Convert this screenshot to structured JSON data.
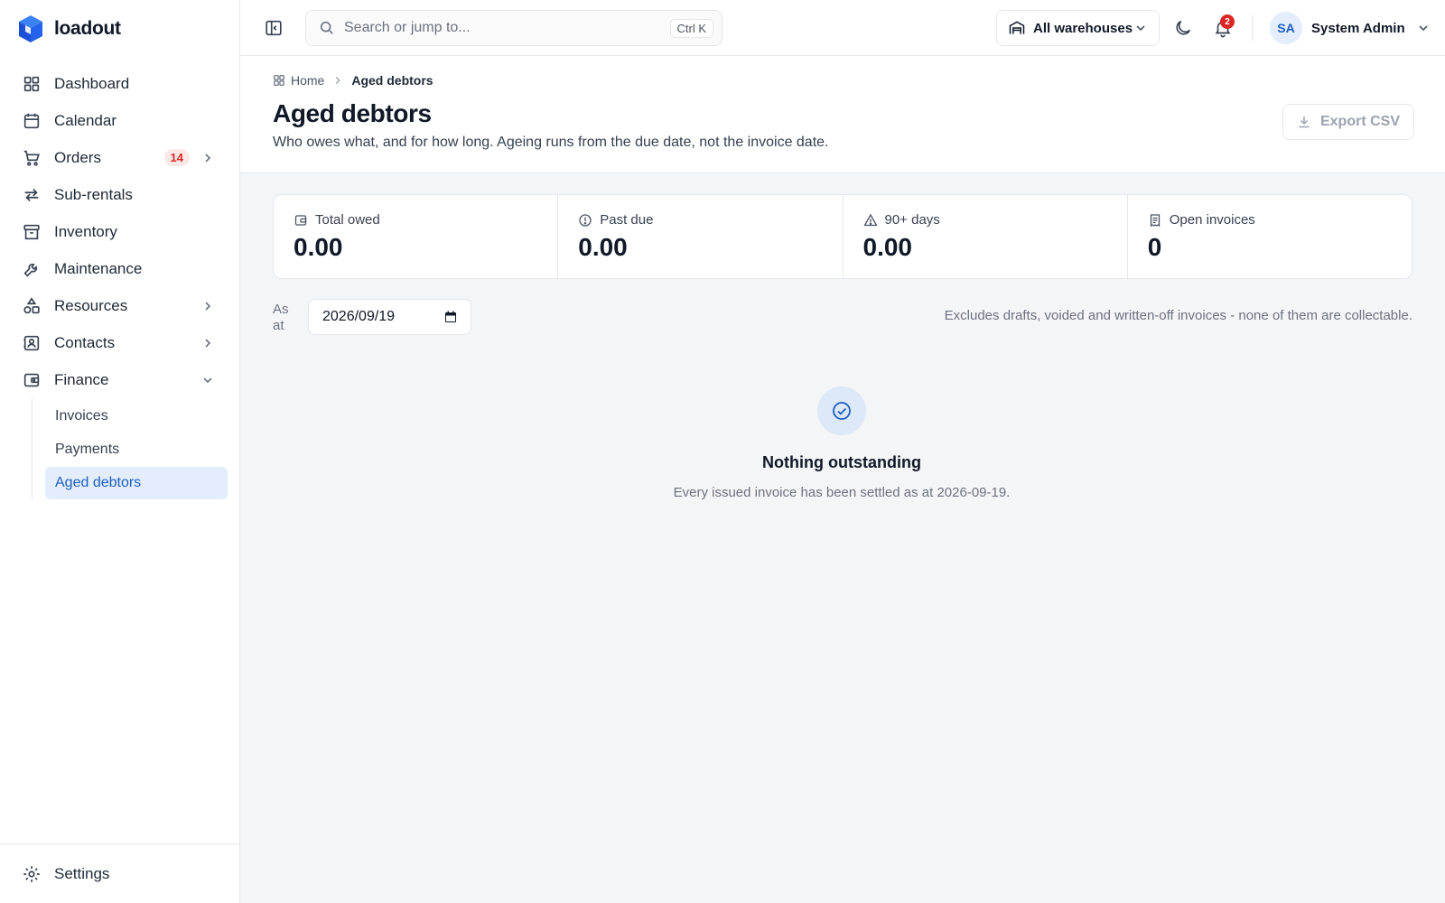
{
  "app": {
    "name": "loadout"
  },
  "sidebar": {
    "items": [
      {
        "label": "Dashboard",
        "icon": "grid-icon"
      },
      {
        "label": "Calendar",
        "icon": "calendar-icon"
      },
      {
        "label": "Orders",
        "icon": "cart-icon",
        "badge": "14"
      },
      {
        "label": "Sub-rentals",
        "icon": "arrows-icon"
      },
      {
        "label": "Inventory",
        "icon": "archive-icon"
      },
      {
        "label": "Maintenance",
        "icon": "wrench-icon"
      },
      {
        "label": "Resources",
        "icon": "shapes-icon"
      },
      {
        "label": "Contacts",
        "icon": "contact-icon"
      },
      {
        "label": "Finance",
        "icon": "wallet-icon"
      }
    ],
    "finance_sub": [
      {
        "label": "Invoices"
      },
      {
        "label": "Payments"
      },
      {
        "label": "Aged debtors",
        "active": true
      }
    ],
    "settings_label": "Settings"
  },
  "topbar": {
    "search_placeholder": "Search or jump to...",
    "search_shortcut": "Ctrl K",
    "warehouse_label": "All warehouses",
    "notifications_count": "2",
    "user_initials": "SA",
    "user_name": "System Admin"
  },
  "breadcrumb": {
    "home": "Home",
    "current": "Aged debtors"
  },
  "page": {
    "title": "Aged debtors",
    "subtitle": "Who owes what, and for how long. Ageing runs from the due date, not the invoice date.",
    "export_label": "Export CSV"
  },
  "stats": [
    {
      "label": "Total owed",
      "value": "0.00",
      "icon": "wallet-icon"
    },
    {
      "label": "Past due",
      "value": "0.00",
      "icon": "alert-circle-icon"
    },
    {
      "label": "90+ days",
      "value": "0.00",
      "icon": "warning-triangle-icon"
    },
    {
      "label": "Open invoices",
      "value": "0",
      "icon": "receipt-icon"
    }
  ],
  "filter": {
    "as_at_label": "As at",
    "date_value": "2026/09/19",
    "note": "Excludes drafts, voided and written-off invoices - none of them are collectable."
  },
  "empty_state": {
    "title": "Nothing outstanding",
    "text": "Every issued invoice has been settled as at 2026-09-19."
  },
  "colors": {
    "accent": "#1d5fc4",
    "active_bg": "#e3edfb",
    "badge_red": "#dc2626",
    "page_bg": "#f4f5f7"
  }
}
